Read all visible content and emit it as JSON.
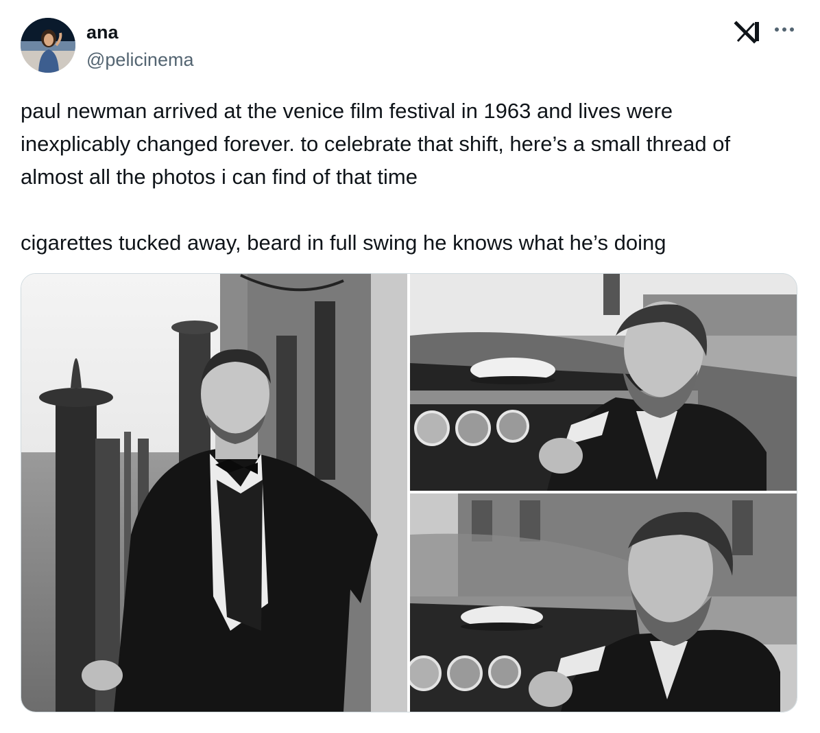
{
  "author": {
    "display_name": "ana",
    "handle": "@pelicinema"
  },
  "icons": {
    "logo": "x-logo-icon",
    "more": "more-options-icon"
  },
  "tweet": {
    "text": "paul newman arrived at the venice film festival in 1963 and lives were inexplicably changed forever. to celebrate that shift, here’s a small thread of almost all the photos i can find of that time\n\ncigarettes tucked away, beard in full swing he knows what he’s doing"
  },
  "media": {
    "count": 3,
    "style": "black-and-white photographs"
  }
}
